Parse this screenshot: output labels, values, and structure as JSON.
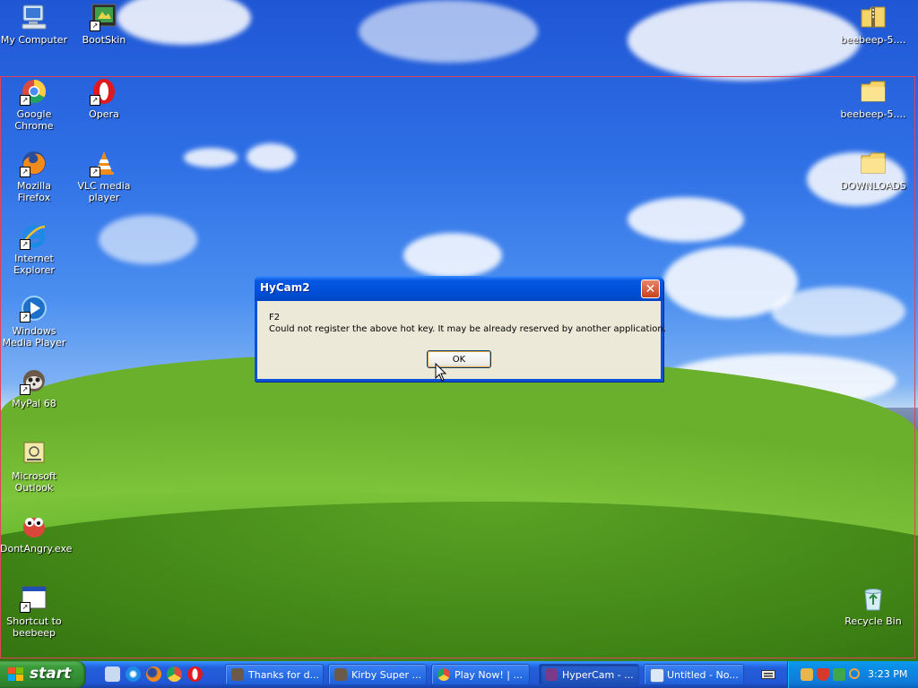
{
  "desktop": {
    "icons": [
      {
        "name": "my-computer-icon",
        "label": "My Computer"
      },
      {
        "name": "bootskin-icon",
        "label": "BootSkin"
      },
      {
        "name": "google-chrome-icon",
        "label": "Google Chrome"
      },
      {
        "name": "opera-icon",
        "label": "Opera"
      },
      {
        "name": "mozilla-firefox-icon",
        "label": "Mozilla Firefox"
      },
      {
        "name": "vlc-icon",
        "label": "VLC media player"
      },
      {
        "name": "internet-explorer-icon",
        "label": "Internet Explorer"
      },
      {
        "name": "windows-media-player-icon",
        "label": "Windows Media Player"
      },
      {
        "name": "mypal-icon",
        "label": "MyPal 68"
      },
      {
        "name": "outlook-icon",
        "label": "Microsoft Outlook"
      },
      {
        "name": "dontangry-icon",
        "label": "DontAngry.exe"
      },
      {
        "name": "beebeep-shortcut-icon",
        "label": "Shortcut to beebeep"
      },
      {
        "name": "beebeep-zip-icon",
        "label": "beebeep-5...."
      },
      {
        "name": "beebeep-folder-icon",
        "label": "beebeep-5...."
      },
      {
        "name": "downloads-folder-icon",
        "label": "DOWNLOADS"
      },
      {
        "name": "recycle-bin-icon",
        "label": "Recycle Bin"
      }
    ]
  },
  "dialog": {
    "title": "HyCam2",
    "close_label": "✕",
    "message_line1": "F2",
    "message_line2": "Could not register the above hot key. It may be already reserved by another application.",
    "ok_label": "OK"
  },
  "taskbar": {
    "start_label": "start",
    "quick_launch": [
      "show-desktop-icon",
      "internet-explorer-icon",
      "firefox-icon",
      "chrome-icon",
      "opera-icon"
    ],
    "tasks": [
      {
        "label": "Thanks for d..."
      },
      {
        "label": "Kirby Super ..."
      },
      {
        "label": "Play Now! | ..."
      },
      {
        "label": "HyperCam - ..."
      },
      {
        "label": "Untitled - No..."
      }
    ],
    "clock": "3:23 PM"
  },
  "colors": {
    "taskbar_blue": "#245edb",
    "start_green": "#3c9d3c",
    "tray_blue": "#0f7ad8",
    "dialog_face": "#ece9d8",
    "capture_frame": "#e0435a"
  }
}
